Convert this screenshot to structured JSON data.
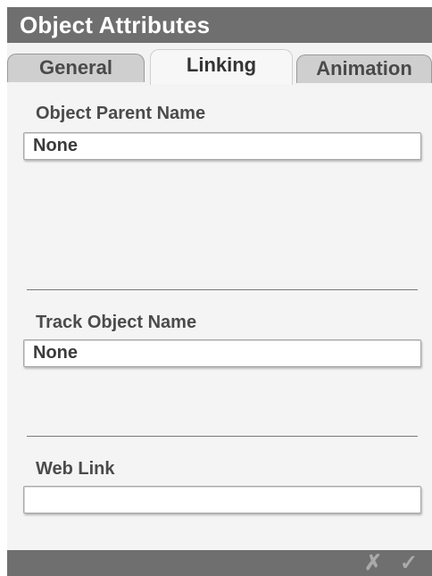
{
  "window": {
    "title": "Object Attributes"
  },
  "tabs": [
    {
      "label": "General",
      "active": false
    },
    {
      "label": "Linking",
      "active": true
    },
    {
      "label": "Animation",
      "active": false
    }
  ],
  "fields": {
    "object_parent": {
      "label": "Object Parent Name",
      "value": "None"
    },
    "track_object": {
      "label": "Track Object Name",
      "value": "None"
    },
    "web_link": {
      "label": "Web Link",
      "value": ""
    }
  },
  "actions": {
    "cancel_icon": "✗",
    "confirm_icon": "✓"
  },
  "colors": {
    "titlebar": "#6f6f6f",
    "panel": "#f4f4f4",
    "field_bg": "#ffffff"
  }
}
